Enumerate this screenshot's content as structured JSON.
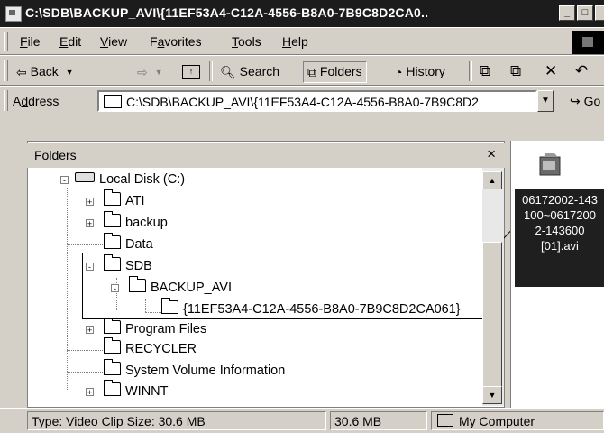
{
  "window": {
    "title": "C:\\SDB\\BACKUP_AVI\\{11EF53A4-C12A-4556-B8A0-7B9C8D2CA0.."
  },
  "menu": [
    {
      "key": "F",
      "rest": "ile"
    },
    {
      "key": "E",
      "rest": "dit"
    },
    {
      "key": "V",
      "rest": "iew"
    },
    {
      "pre": "F",
      "key": "a",
      "rest": "vorites"
    },
    {
      "key": "T",
      "rest": "ools"
    },
    {
      "key": "H",
      "rest": "elp"
    }
  ],
  "toolbar": {
    "back": "Back",
    "search": "Search",
    "folders": "Folders",
    "history": "History"
  },
  "address": {
    "label_pre": "A",
    "label_key": "d",
    "label_post": "dress",
    "value": "C:\\SDB\\BACKUP_AVI\\{11EF53A4-C12A-4556-B8A0-7B9C8D2",
    "go": "Go"
  },
  "folders_pane": {
    "title": "Folders",
    "close": "×",
    "tree": [
      {
        "label": "Local Disk (C:)",
        "expander": "-"
      },
      {
        "label": "ATI",
        "expander": "+"
      },
      {
        "label": "backup",
        "expander": "+"
      },
      {
        "label": "Data",
        "expander": ""
      },
      {
        "label": "SDB",
        "expander": "-"
      },
      {
        "label": "BACKUP_AVI",
        "expander": "-"
      },
      {
        "label": "{11EF53A4-C12A-4556-B8A0-7B9C8D2CA061}",
        "expander": ""
      },
      {
        "label": "Program Files",
        "expander": "+"
      },
      {
        "label": "RECYCLER",
        "expander": ""
      },
      {
        "label": "System Volume Information",
        "expander": ""
      },
      {
        "label": "WINNT",
        "expander": "+"
      }
    ]
  },
  "file": {
    "line1": "06172002-143",
    "line2": "100~0617200",
    "line3": "2-143600",
    "line4": "[01].avi"
  },
  "status": {
    "info": "Type: Video Clip Size: 30.6 MB",
    "size": "30.6 MB",
    "zone": "My Computer"
  },
  "colors": {
    "title_bg": "#1c1c1c",
    "chrome": "#d4d0c8",
    "selection": "#1f1f1f"
  }
}
